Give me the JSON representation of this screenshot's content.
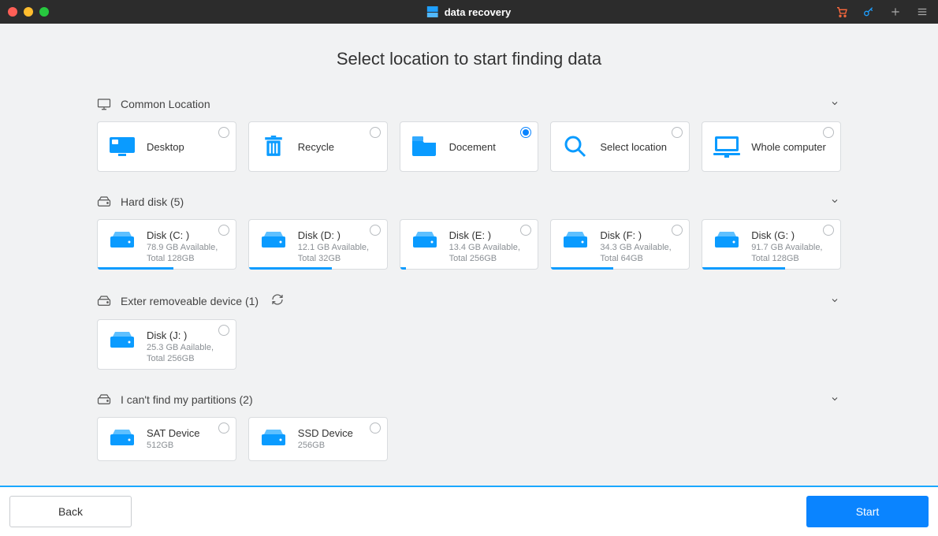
{
  "app": {
    "title": "data recovery"
  },
  "pageTitle": "Select location to  start finding data",
  "sections": {
    "common": {
      "header": "Common Location",
      "items": [
        {
          "label": "Desktop",
          "selected": false
        },
        {
          "label": "Recycle",
          "selected": false
        },
        {
          "label": "Docement",
          "selected": true
        },
        {
          "label": "Select location",
          "selected": false
        },
        {
          "label": "Whole computer",
          "selected": false
        }
      ]
    },
    "harddisk": {
      "header": "Hard disk (5)",
      "items": [
        {
          "name": "Disk (C: )",
          "sub": "78.9 GB Available, Total 128GB",
          "usage": 55
        },
        {
          "name": "Disk (D: )",
          "sub": "12.1 GB Available, Total 32GB",
          "usage": 60
        },
        {
          "name": "Disk (E: )",
          "sub": "13.4 GB Available, Total 256GB",
          "usage": 4
        },
        {
          "name": "Disk (F: )",
          "sub": "34.3 GB Available, Total 64GB",
          "usage": 45
        },
        {
          "name": "Disk (G: )",
          "sub": "91.7 GB Available, Total 128GB",
          "usage": 60
        }
      ]
    },
    "external": {
      "header": "Exter removeable device (1)",
      "items": [
        {
          "name": "Disk (J: )",
          "sub": "25.3 GB Aailable, Total 256GB",
          "usage": 0
        }
      ]
    },
    "partitions": {
      "header": "I can't find my partitions (2)",
      "items": [
        {
          "name": "SAT Device",
          "sub": "512GB"
        },
        {
          "name": "SSD Device",
          "sub": "256GB"
        }
      ]
    }
  },
  "footer": {
    "back": "Back",
    "start": "Start"
  },
  "colors": {
    "accent": "#0a84ff"
  }
}
